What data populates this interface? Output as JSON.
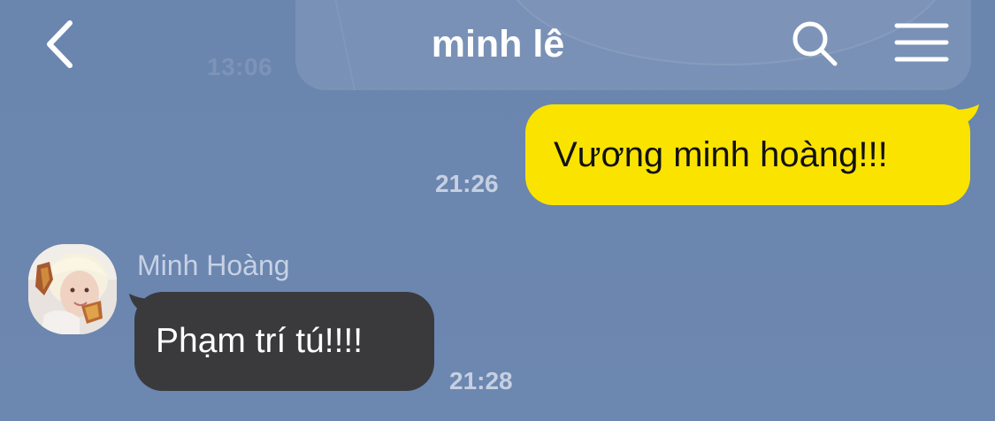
{
  "header": {
    "title": "minh lê",
    "back_icon": "chevron-left-icon",
    "search_icon": "search-icon",
    "menu_icon": "hamburger-menu-icon"
  },
  "background_message": {
    "time": "13:06"
  },
  "messages": [
    {
      "direction": "outgoing",
      "text": "Vương minh hoàng!!!",
      "time": "21:26"
    },
    {
      "direction": "incoming",
      "sender": "Minh Hoàng",
      "text": "Phạm trí tú!!!!",
      "time": "21:28"
    }
  ],
  "colors": {
    "background": "#6b86ae",
    "outgoing_bubble": "#fbe300",
    "incoming_bubble": "#3a3a3d",
    "timestamp": "#c6d0e2"
  }
}
